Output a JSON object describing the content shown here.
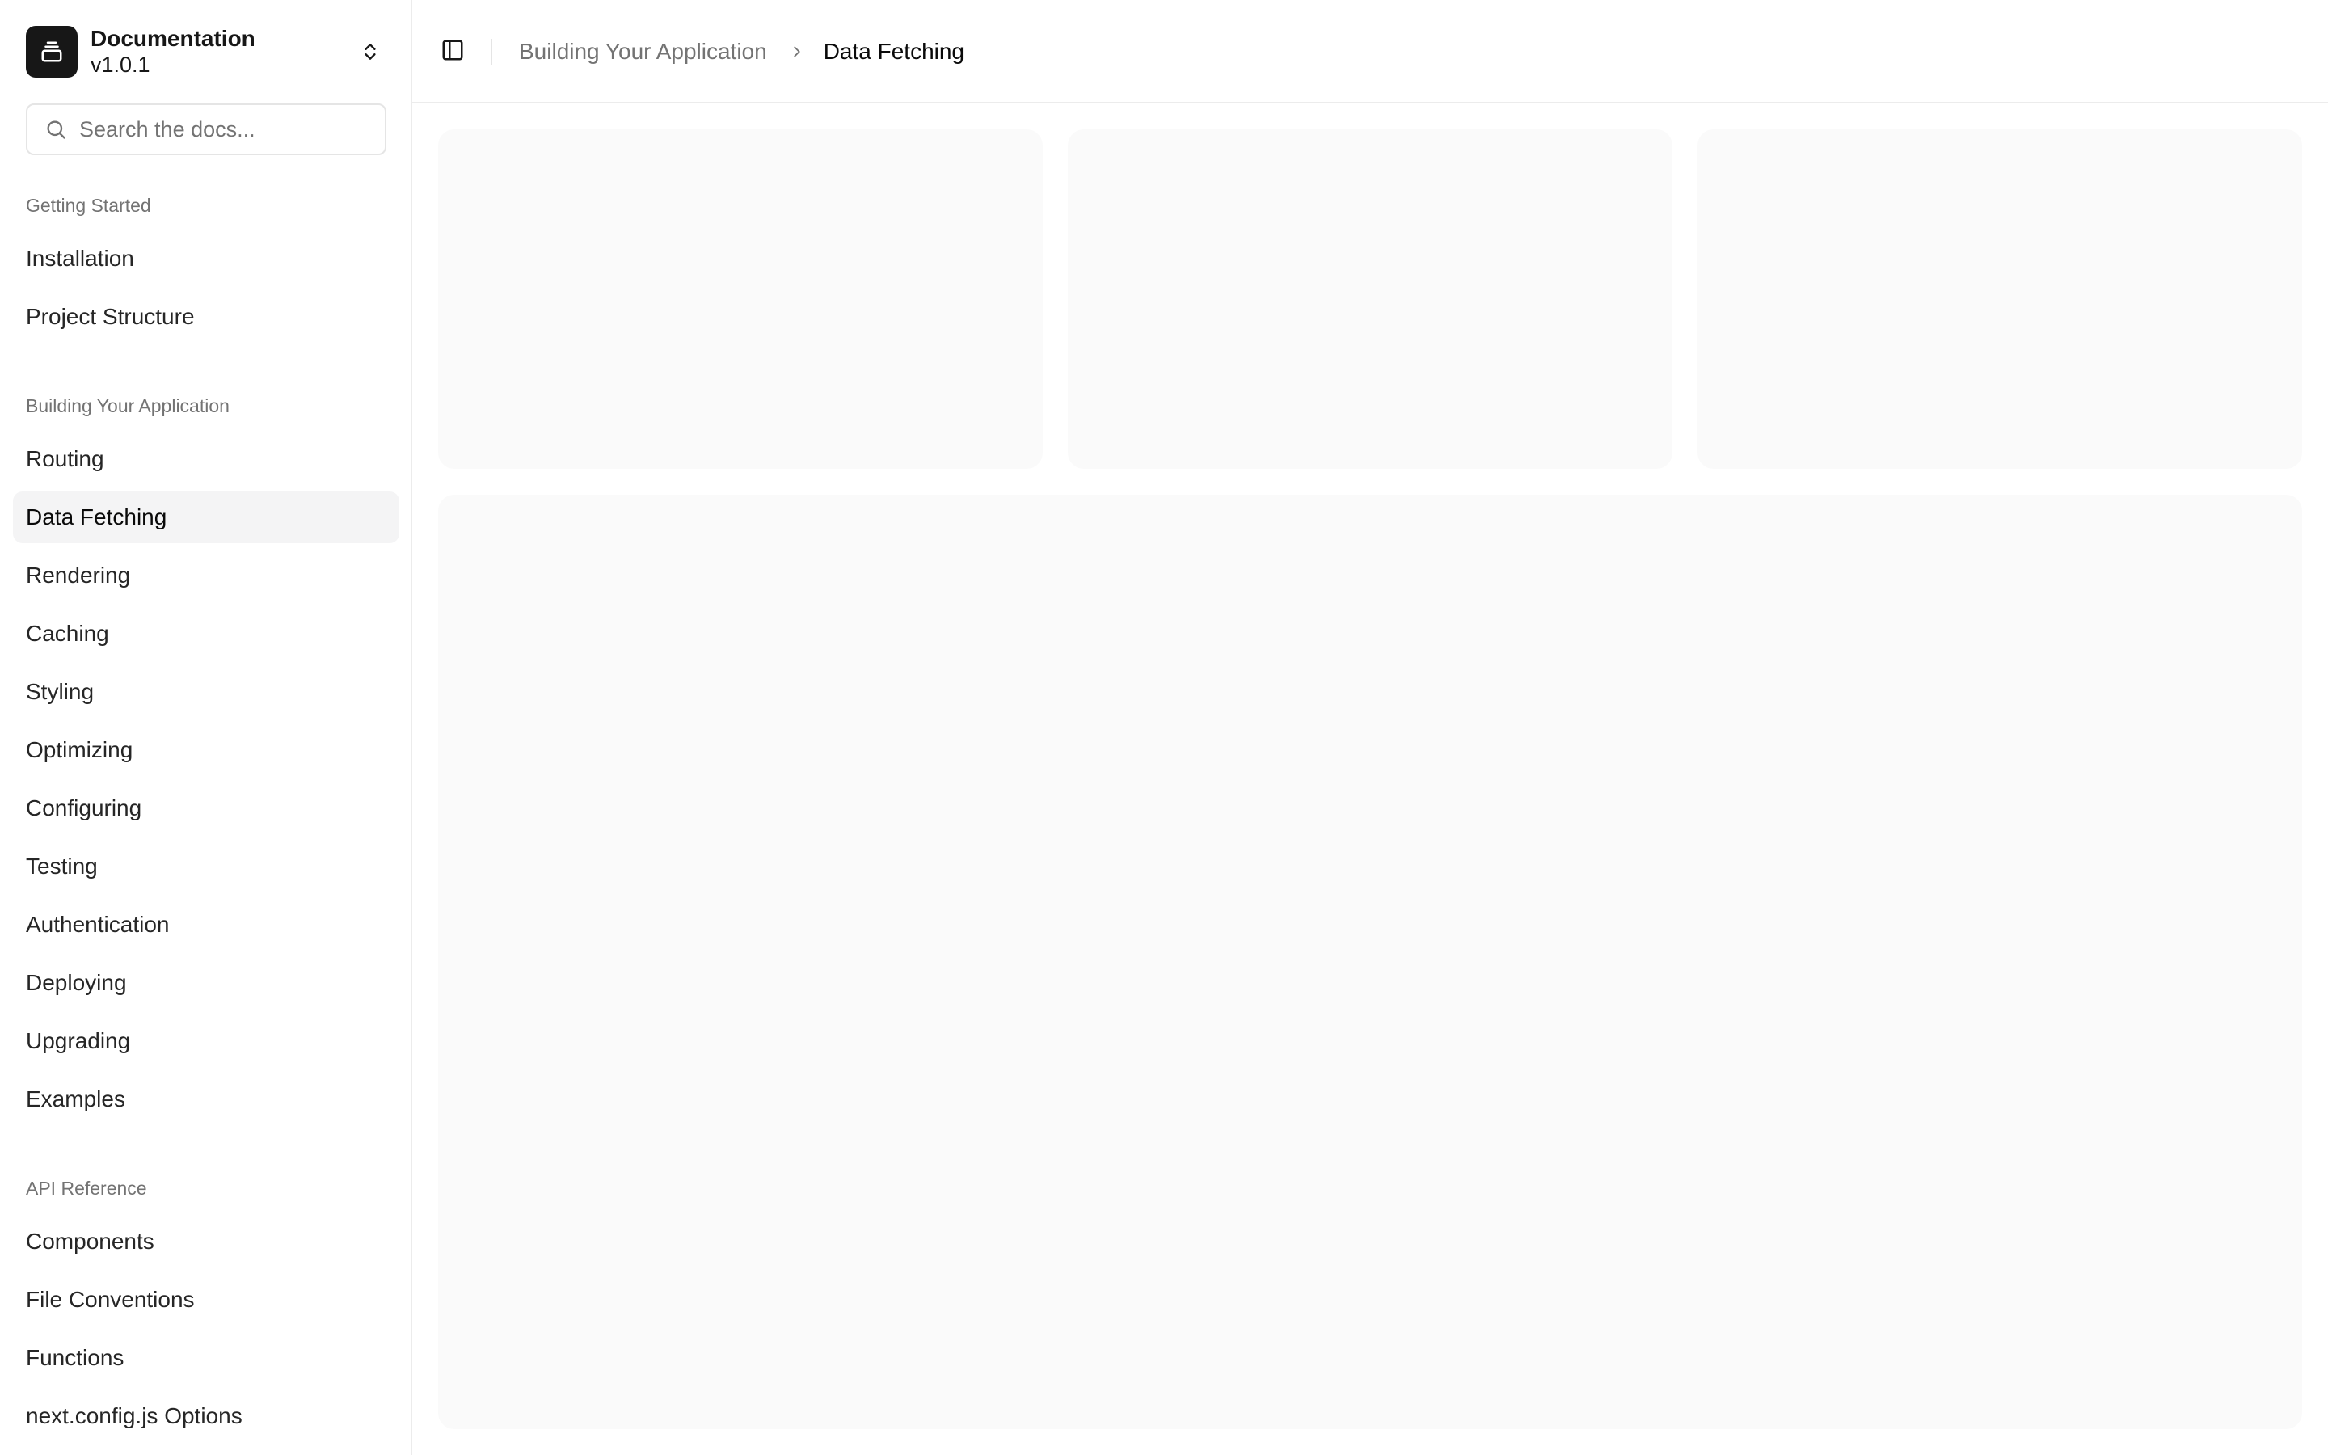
{
  "brand": {
    "title": "Documentation",
    "version": "v1.0.1"
  },
  "search": {
    "placeholder": "Search the docs..."
  },
  "sidebar": {
    "groups": [
      {
        "label": "Getting Started",
        "items": [
          "Installation",
          "Project Structure"
        ]
      },
      {
        "label": "Building Your Application",
        "items": [
          "Routing",
          "Data Fetching",
          "Rendering",
          "Caching",
          "Styling",
          "Optimizing",
          "Configuring",
          "Testing",
          "Authentication",
          "Deploying",
          "Upgrading",
          "Examples"
        ]
      },
      {
        "label": "API Reference",
        "items": [
          "Components",
          "File Conventions",
          "Functions",
          "next.config.js Options"
        ]
      }
    ],
    "active_item": "Data Fetching"
  },
  "breadcrumb": {
    "parent": "Building Your Application",
    "current": "Data Fetching"
  },
  "colors": {
    "sidebar_active_bg": "#f4f4f5",
    "skeleton": "#fafafa",
    "brand_logo": "#171717"
  }
}
